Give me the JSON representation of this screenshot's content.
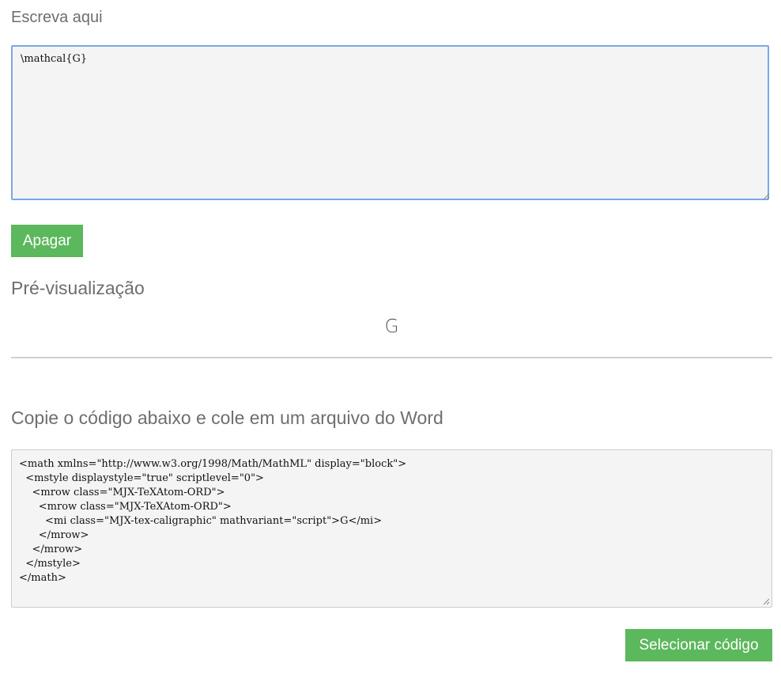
{
  "input_section": {
    "label": "Escreva aqui",
    "editor_value": "\\mathcal{G}"
  },
  "clear_button": {
    "label": "Apagar"
  },
  "preview_section": {
    "label": "Pré-visualização",
    "rendered_output": "G"
  },
  "code_section": {
    "label": "Copie o código abaixo e cole em um arquivo do Word",
    "code": "<math xmlns=\"http://www.w3.org/1998/Math/MathML\" display=\"block\">\n  <mstyle displaystyle=\"true\" scriptlevel=\"0\">\n    <mrow class=\"MJX-TeXAtom-ORD\">\n      <mrow class=\"MJX-TeXAtom-ORD\">\n        <mi class=\"MJX-tex-caligraphic\" mathvariant=\"script\">G</mi>\n      </mrow>\n    </mrow>\n  </mstyle>\n</math>"
  },
  "select_button": {
    "label": "Selecionar código"
  },
  "colors": {
    "button_green": "#5cb85c",
    "focus_border": "#7aa7e8",
    "field_background": "#f4f4f4"
  },
  "icons": {
    "resize_grip": "resize-grip-icon"
  }
}
